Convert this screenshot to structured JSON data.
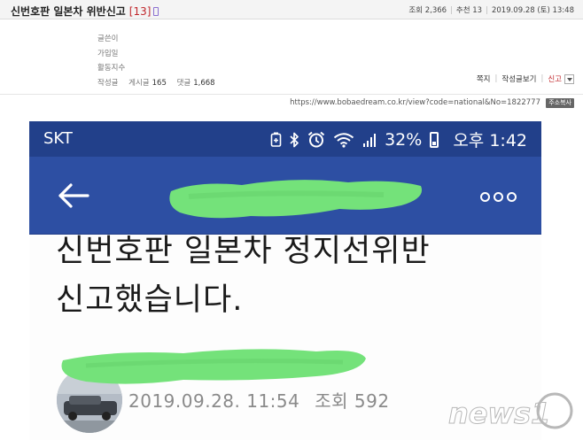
{
  "post": {
    "title": "신번호판 일본차 위반신고",
    "comment_count": "[13]",
    "views_label": "조회",
    "views": "2,366",
    "recommend_label": "추천",
    "recommend": "13",
    "date": "2019.09.28 (토) 13:48"
  },
  "author": {
    "writer_label": "글쓴이",
    "joined_label": "가입일",
    "activity_label": "활동지수",
    "written_label": "작성글",
    "posts_label": "게시글",
    "posts": "165",
    "comments_label": "댓글",
    "comments": "1,668"
  },
  "actions": {
    "message": "쪽지",
    "view_posts": "작성글보기",
    "report": "신고"
  },
  "url": {
    "text": "https://www.bobaedream.co.kr/view?code=national&No=1822777",
    "copy_label": "주소복사"
  },
  "screenshot": {
    "carrier": "SKT",
    "battery": "32%",
    "time": "오후 1:42",
    "headline_line1": "신번호판 일본차 정지선위반",
    "headline_line2": "신고했습니다.",
    "post_date": "2019.09.28. 11:54",
    "views_label": "조회",
    "views": "592"
  },
  "watermark": {
    "text": "news1"
  },
  "colors": {
    "status_bar": "#22408a",
    "app_bar": "#2d4fa3",
    "redaction_green": "#74e27a",
    "report_red": "#c0282d"
  },
  "icons": [
    "mobile-icon",
    "battery-saver-icon",
    "bluetooth-icon",
    "alarm-icon",
    "wifi-icon",
    "signal-icon",
    "battery-icon",
    "back-arrow-icon",
    "more-options-icon",
    "dropdown-icon"
  ]
}
